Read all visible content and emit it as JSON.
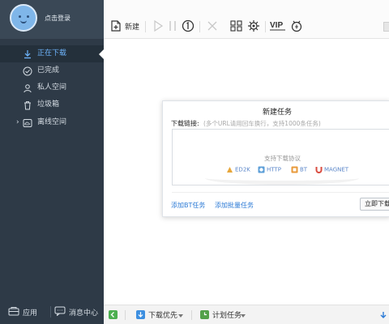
{
  "user": {
    "login_label": "点击登录"
  },
  "sidebar": {
    "items": [
      {
        "label": "正在下载",
        "icon": "download-icon",
        "active": true
      },
      {
        "label": "已完成",
        "icon": "check-circle-icon"
      },
      {
        "label": "私人空间",
        "icon": "person-icon"
      },
      {
        "label": "垃圾箱",
        "icon": "trash-icon"
      },
      {
        "label": "离线空间",
        "icon": "cloud-icon",
        "expandable": true
      }
    ],
    "bottom": {
      "apps_label": "应用",
      "messages_label": "消息中心"
    }
  },
  "toolbar": {
    "new_label": "新建",
    "vip_label": "VIP",
    "icons": [
      "new-task-icon",
      "play-icon",
      "pause-icon",
      "delete-icon",
      "grid-icon",
      "settings-icon",
      "vip-icon",
      "medal-icon"
    ]
  },
  "dialog": {
    "title": "新建任务",
    "field_label": "下载链接:",
    "hint": "(多个URL请用回车换行，支持1000条任务)",
    "protocols_title": "支持下载协议",
    "protocols": [
      "ED2K",
      "HTTP",
      "BT",
      "MAGNET"
    ],
    "add_bt_label": "添加BT任务",
    "add_batch_label": "添加批量任务",
    "download_now_label": "立即下载"
  },
  "statusbar": {
    "priority_label": "下载优先",
    "schedule_label": "计划任务"
  },
  "colors": {
    "sidebar_bg": "#2e3a47",
    "active_text": "#6fb6ff",
    "link": "#2d7bd6"
  }
}
